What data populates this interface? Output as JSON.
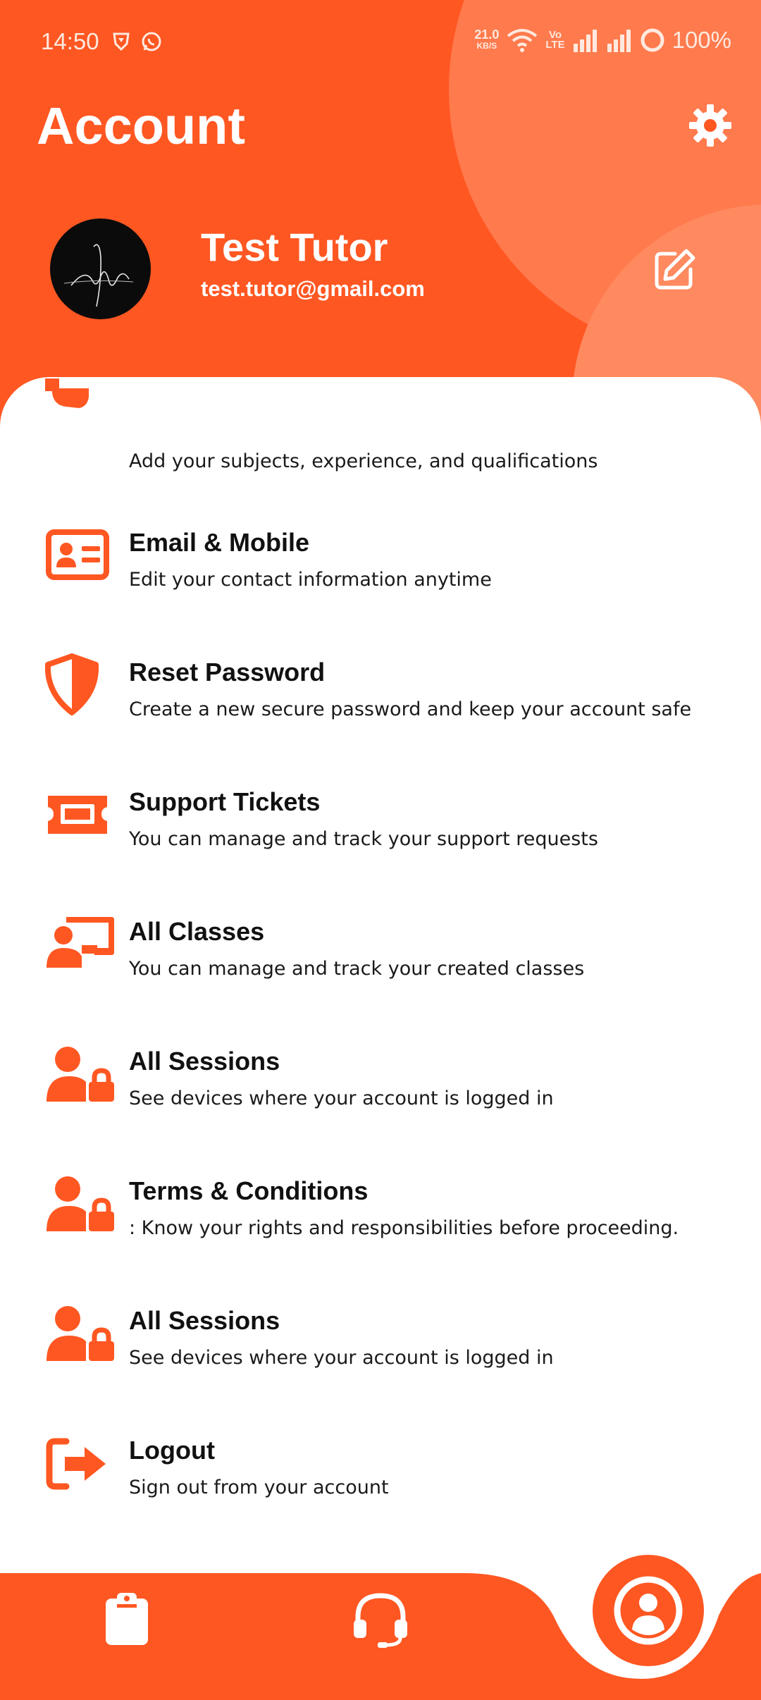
{
  "status_bar": {
    "time": "14:50",
    "net_speed": "21.0",
    "net_unit": "KB/S",
    "volte_top": "Vo",
    "volte_bottom": "LTE",
    "battery": "100%"
  },
  "header": {
    "title": "Account",
    "accent_color": "#FF5722"
  },
  "profile": {
    "name": "Test Tutor",
    "email": "test.tutor@gmail.com",
    "avatar_signature": "hope"
  },
  "menu": [
    {
      "icon": "graduation-cap-icon",
      "title": "",
      "subtitle": "Add your subjects, experience, and qualifications"
    },
    {
      "icon": "id-card-icon",
      "title": "Email & Mobile",
      "subtitle": "Edit your contact information anytime"
    },
    {
      "icon": "shield-icon",
      "title": "Reset Password",
      "subtitle": "Create a new secure password and keep your account safe"
    },
    {
      "icon": "ticket-icon",
      "title": "Support Tickets",
      "subtitle": "You can manage and track your support requests"
    },
    {
      "icon": "chalkboard-teacher-icon",
      "title": "All Classes",
      "subtitle": "You can manage and track your created classes"
    },
    {
      "icon": "user-lock-icon",
      "title": "All Sessions",
      "subtitle": "See devices where your account is logged in"
    },
    {
      "icon": "user-lock-icon",
      "title": "Terms & Conditions",
      "subtitle": ": Know your rights and responsibilities before proceeding."
    },
    {
      "icon": "user-lock-icon",
      "title": "All Sessions",
      "subtitle": "See devices where your account is logged in"
    },
    {
      "icon": "logout-icon",
      "title": "Logout",
      "subtitle": "Sign out from your account"
    }
  ],
  "bottom_nav": [
    {
      "icon": "clipboard-icon",
      "active": false
    },
    {
      "icon": "headset-icon",
      "active": false
    },
    {
      "icon": "user-circle-icon",
      "active": true
    }
  ]
}
